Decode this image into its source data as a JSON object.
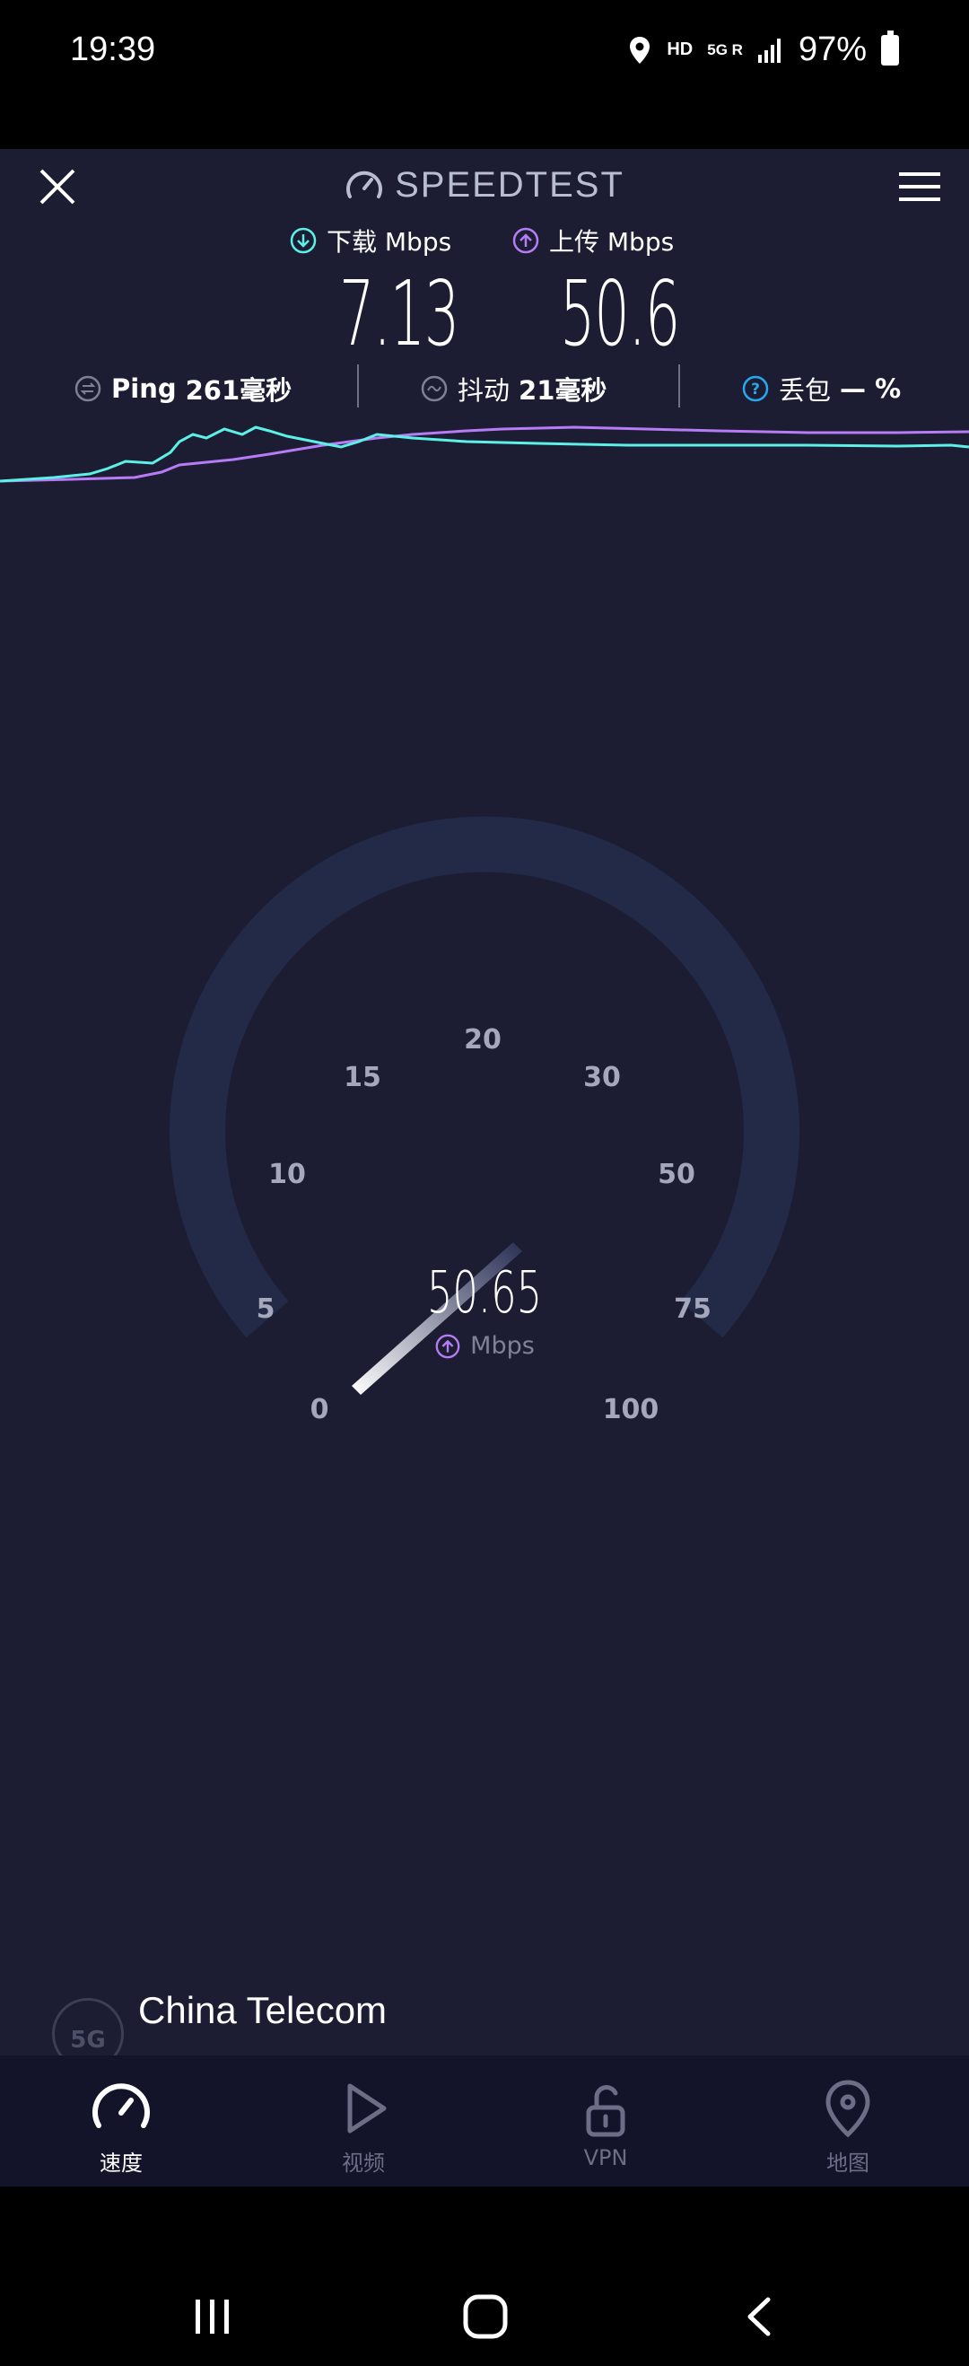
{
  "status_bar": {
    "time": "19:39",
    "hd": "HD",
    "network": "5G R",
    "battery": "97%"
  },
  "header": {
    "title": "SPEEDTEST"
  },
  "download": {
    "label": "下载 Mbps",
    "value": "7.13"
  },
  "upload": {
    "label": "上传 Mbps",
    "value": "50.6"
  },
  "stats": {
    "ping": {
      "label": "Ping",
      "value": "261毫秒"
    },
    "jitter": {
      "label": "抖动",
      "value": "21毫秒"
    },
    "loss": {
      "label": "丢包",
      "value": "— %"
    }
  },
  "gauge": {
    "ticks": [
      "0",
      "5",
      "10",
      "15",
      "20",
      "30",
      "50",
      "75",
      "100"
    ],
    "value": "50.65",
    "unit": "Mbps"
  },
  "isp": {
    "badge": "5G",
    "name": "China Telecom"
  },
  "nav": {
    "speed": "速度",
    "video": "视频",
    "vpn": "VPN",
    "map": "地图"
  },
  "colors": {
    "download": "#5cf0e6",
    "upload": "#b67cf5",
    "background": "#1c1d32",
    "loss_icon": "#27a8f0"
  }
}
